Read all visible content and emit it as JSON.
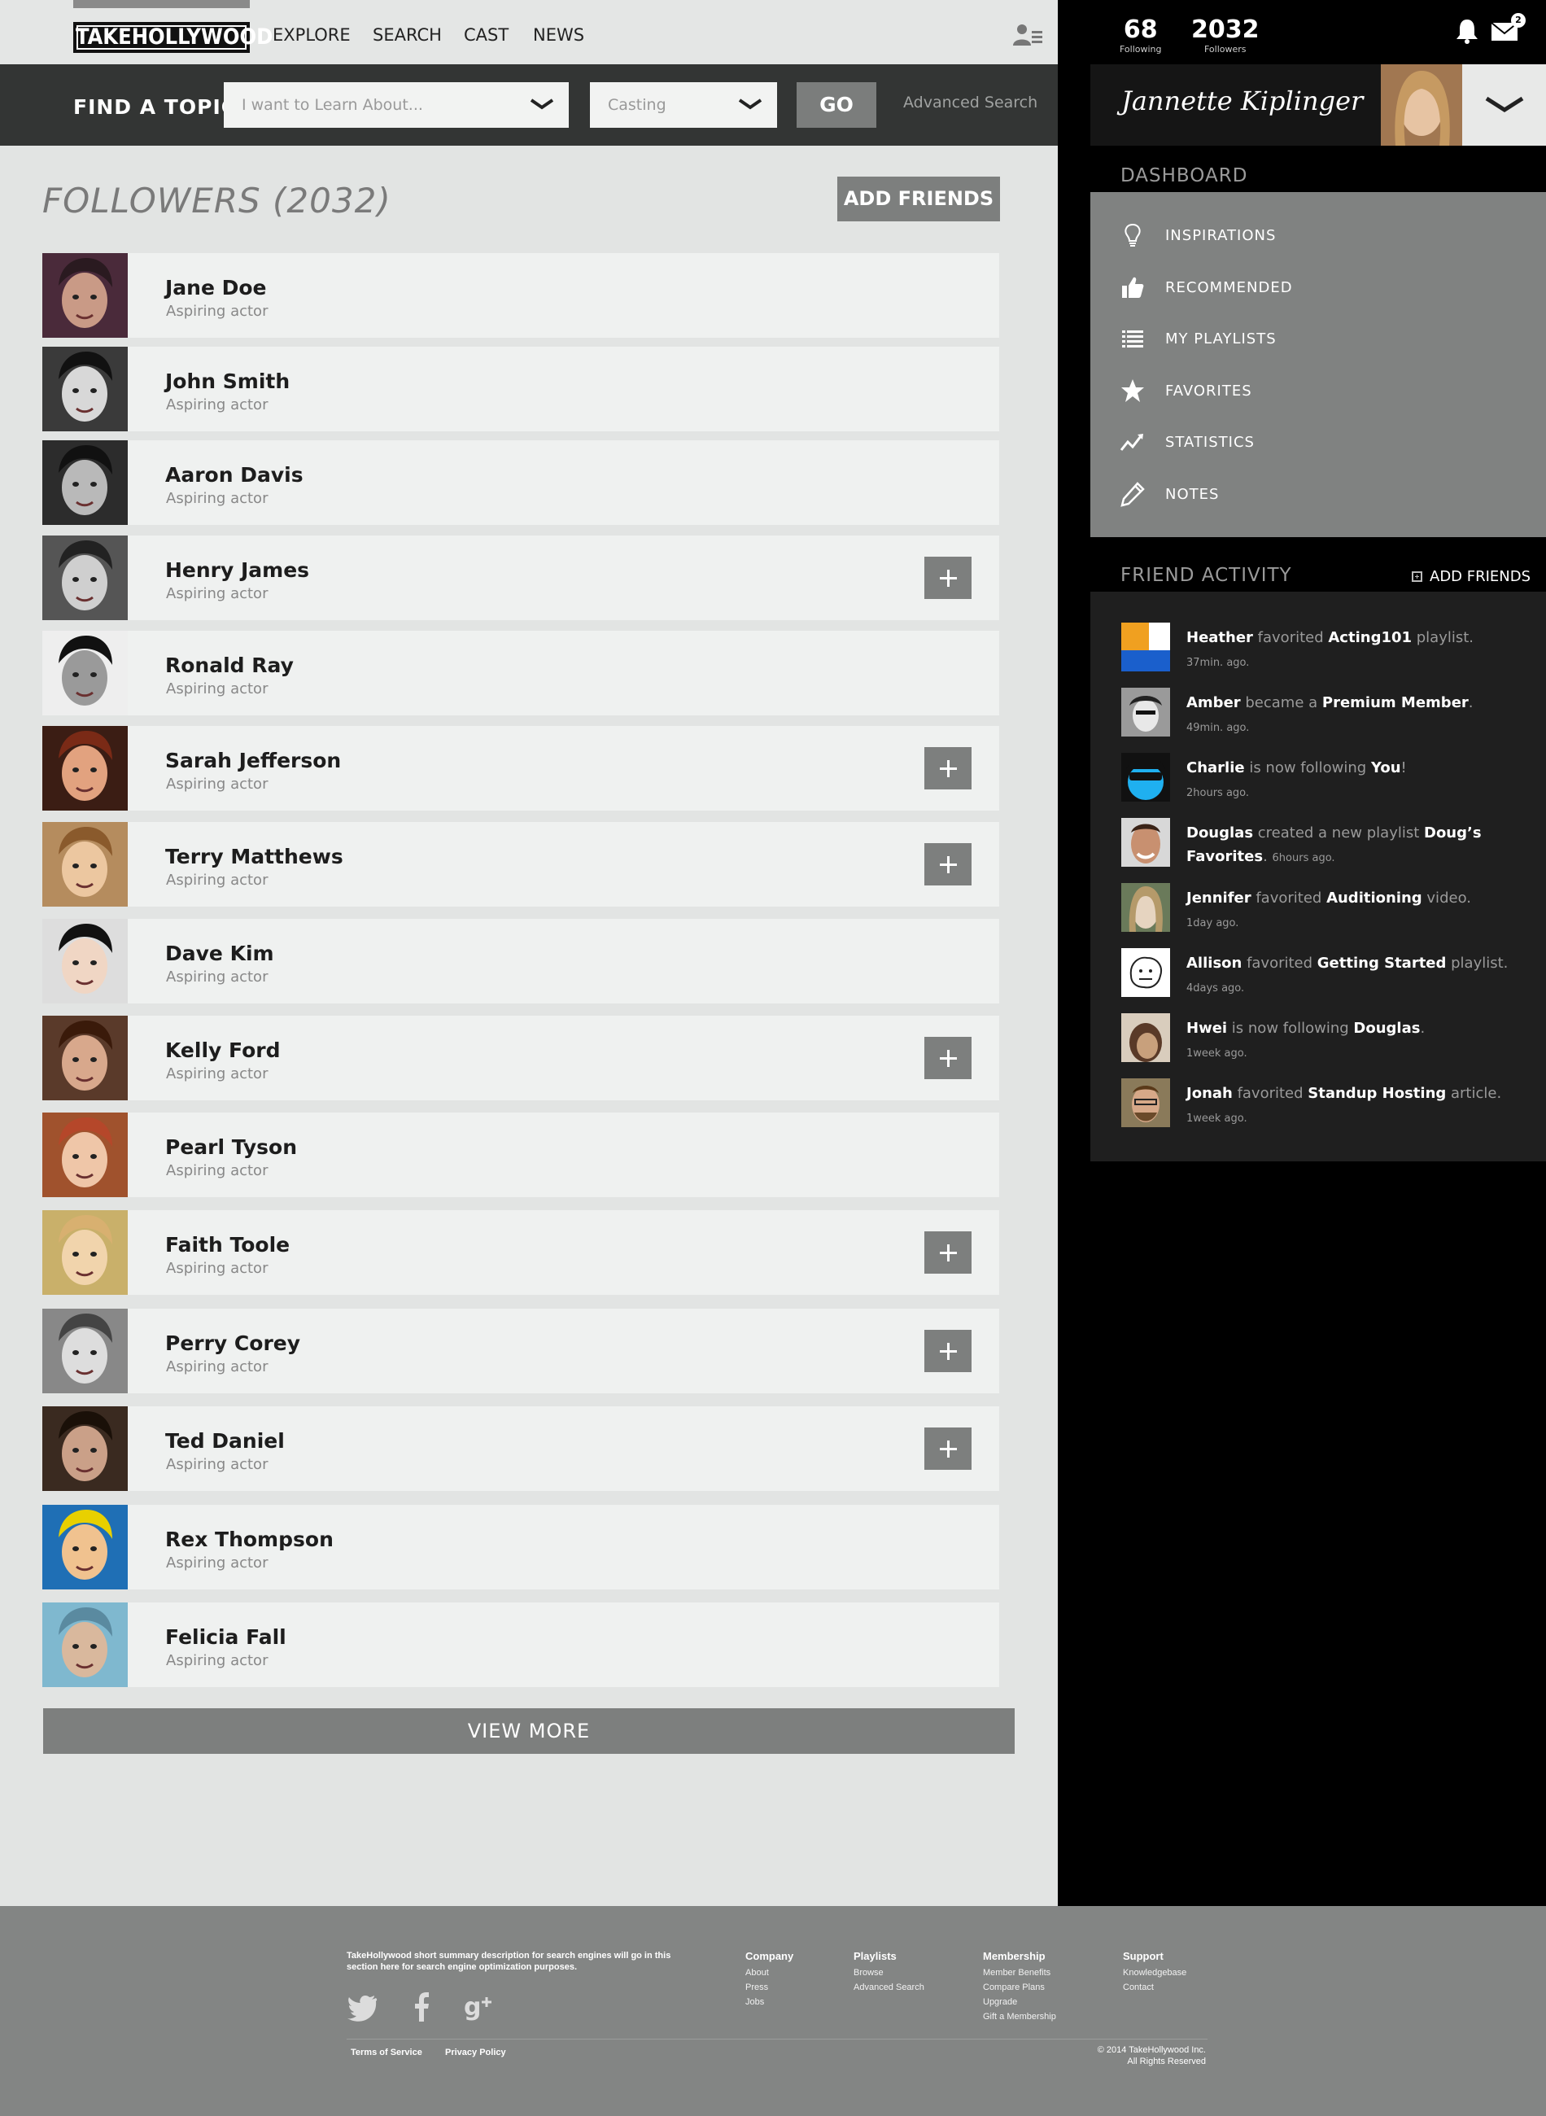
{
  "brand": {
    "logo_text": "TAKEHOLLYWOOD"
  },
  "nav": [
    "EXPLORE",
    "SEARCH",
    "CAST",
    "NEWS"
  ],
  "topic_bar": {
    "label": "FIND A TOPIC",
    "learn_placeholder": "I want to Learn About...",
    "casting_value": "Casting",
    "go_label": "GO",
    "advanced_label": "Advanced Search"
  },
  "stats": {
    "following_num": "68",
    "following_label": "Following",
    "followers_num": "2032",
    "followers_label": "Followers",
    "mail_count": "2"
  },
  "user": {
    "name": "Jannette Kiplinger"
  },
  "followers": {
    "title": "FOLLOWERS (2032)",
    "add_friends_label": "ADD FRIENDS",
    "view_more_label": "VIEW MORE",
    "rows": [
      {
        "name": "Jane Doe",
        "role": "Aspiring actor",
        "addable": false
      },
      {
        "name": "John Smith",
        "role": "Aspiring actor",
        "addable": false
      },
      {
        "name": "Aaron Davis",
        "role": "Aspiring actor",
        "addable": false
      },
      {
        "name": "Henry James",
        "role": "Aspiring actor",
        "addable": true
      },
      {
        "name": "Ronald Ray",
        "role": "Aspiring actor",
        "addable": false
      },
      {
        "name": "Sarah Jefferson",
        "role": "Aspiring actor",
        "addable": true
      },
      {
        "name": "Terry Matthews",
        "role": "Aspiring actor",
        "addable": true
      },
      {
        "name": "Dave Kim",
        "role": "Aspiring actor",
        "addable": false
      },
      {
        "name": "Kelly Ford",
        "role": "Aspiring actor",
        "addable": true
      },
      {
        "name": "Pearl Tyson",
        "role": "Aspiring actor",
        "addable": false
      },
      {
        "name": "Faith Toole",
        "role": "Aspiring actor",
        "addable": true
      },
      {
        "name": "Perry Corey",
        "role": "Aspiring actor",
        "addable": true
      },
      {
        "name": "Ted Daniel",
        "role": "Aspiring actor",
        "addable": true
      },
      {
        "name": "Rex Thompson",
        "role": "Aspiring actor",
        "addable": false
      },
      {
        "name": "Felicia Fall",
        "role": "Aspiring actor",
        "addable": false
      }
    ]
  },
  "dashboard": {
    "title": "DASHBOARD",
    "items": [
      {
        "label": "INSPIRATIONS",
        "icon": "lightbulb-icon"
      },
      {
        "label": "RECOMMENDED",
        "icon": "thumbs-up-icon"
      },
      {
        "label": "MY PLAYLISTS",
        "icon": "list-icon"
      },
      {
        "label": "FAVORITES",
        "icon": "star-icon"
      },
      {
        "label": "STATISTICS",
        "icon": "chart-icon"
      },
      {
        "label": "NOTES",
        "icon": "pencil-icon"
      }
    ]
  },
  "friend_activity": {
    "title": "FRIEND ACTIVITY",
    "add_label": "ADD FRIENDS",
    "items": [
      {
        "who": "Heather",
        "verb": " favorited ",
        "what": "Acting101",
        "tail": " playlist.",
        "time": "37min. ago."
      },
      {
        "who": "Amber",
        "verb": " became a ",
        "what": "Premium Member",
        "tail": ".",
        "time": "49min. ago."
      },
      {
        "who": "Charlie",
        "verb": " is now following ",
        "what": "You",
        "tail": "!",
        "time": "2hours ago."
      },
      {
        "who": "Douglas",
        "verb": " created a new playlist ",
        "what": "Doug’s Favorites",
        "tail": ".",
        "time": "6hours ago."
      },
      {
        "who": "Jennifer",
        "verb": " favorited ",
        "what": "Auditioning",
        "tail": " video.",
        "time": "1day ago."
      },
      {
        "who": "Allison",
        "verb": " favorited ",
        "what": "Getting Started",
        "tail": " playlist.",
        "time": "4days ago."
      },
      {
        "who": "Hwei",
        "verb": " is now following ",
        "what": "Douglas",
        "tail": ".",
        "time": "1week ago."
      },
      {
        "who": "Jonah",
        "verb": " favorited ",
        "what": "Standup Hosting",
        "tail": " article.",
        "time": "1week ago."
      }
    ]
  },
  "footer": {
    "description": "TakeHollywood short summary description for  search engines will go in this section here for search engine optimization purposes.",
    "columns": [
      {
        "heading": "Company",
        "links": [
          "About",
          "Press",
          "Jobs"
        ]
      },
      {
        "heading": "Playlists",
        "links": [
          "Browse",
          "Advanced Search"
        ]
      },
      {
        "heading": "Membership",
        "links": [
          "Member Benefits",
          "Compare Plans",
          "Upgrade",
          "Gift a Membership"
        ]
      },
      {
        "heading": "Support",
        "links": [
          "Knowledgebase",
          "Contact"
        ]
      }
    ],
    "terms": "Terms of Service",
    "privacy": "Privacy Policy",
    "copyright_1": "© 2014 TakeHollywood Inc.",
    "copyright_2": "All Rights Reserved"
  }
}
